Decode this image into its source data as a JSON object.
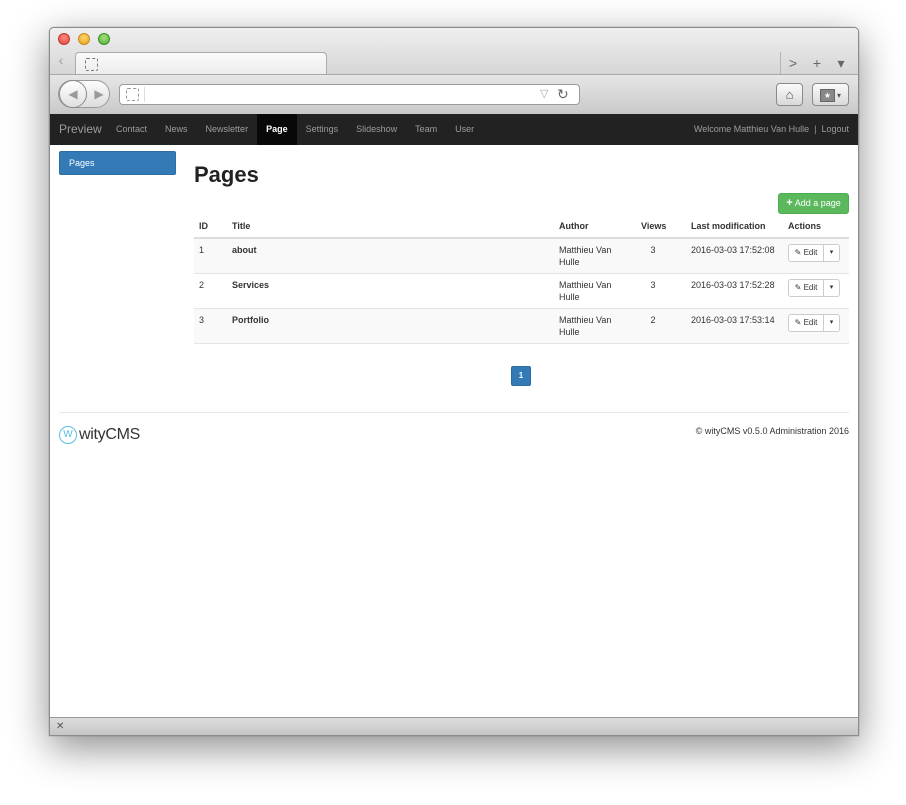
{
  "browser": {
    "tab_back_glyph": "‹",
    "tab_actions": [
      ">",
      "+",
      "▾"
    ],
    "nav_back_glyph": "◀",
    "nav_forward_glyph": "▶",
    "url": "",
    "url_dropdown_glyph": "▽",
    "reload_glyph": "↻",
    "home_glyph": "⌂",
    "bookmarks_glyph": "★",
    "bookmarks_caret": "▾",
    "status_close_glyph": "✕"
  },
  "navbar": {
    "brand": "Preview",
    "items": [
      {
        "label": "Contact"
      },
      {
        "label": "News"
      },
      {
        "label": "Newsletter"
      },
      {
        "label": "Page"
      },
      {
        "label": "Settings"
      },
      {
        "label": "Slideshow"
      },
      {
        "label": "Team"
      },
      {
        "label": "User"
      }
    ],
    "active": "Page",
    "welcome": "Welcome Matthieu Van Hulle",
    "separator": "|",
    "logout": "Logout"
  },
  "sidebar": {
    "items": [
      {
        "label": "Pages"
      }
    ]
  },
  "main": {
    "title": "Pages",
    "add_button": "Add a page",
    "add_icon": "+"
  },
  "table": {
    "headers": {
      "id": "ID",
      "title": "Title",
      "author": "Author",
      "views": "Views",
      "last_modification": "Last modification",
      "actions": "Actions"
    },
    "rows": [
      {
        "id": "1",
        "title": "about",
        "author": "Matthieu Van Hulle",
        "views": "3",
        "last_modification": "2016-03-03 17:52:08",
        "edit": "Edit"
      },
      {
        "id": "2",
        "title": "Services",
        "author": "Matthieu Van Hulle",
        "views": "3",
        "last_modification": "2016-03-03 17:52:28",
        "edit": "Edit"
      },
      {
        "id": "3",
        "title": "Portfolio",
        "author": "Matthieu Van Hulle",
        "views": "2",
        "last_modification": "2016-03-03 17:53:14",
        "edit": "Edit"
      }
    ],
    "edit_icon": "✎",
    "caret_icon": "▾"
  },
  "pagination": {
    "current": "1"
  },
  "footer": {
    "logo_mark": "W",
    "logo_text": "wityCMS",
    "copyright": "© wityCMS v0.5.0 Administration 2016"
  },
  "colors": {
    "navbar_bg": "#222222",
    "primary": "#337ab7",
    "success": "#5cb85c",
    "logo_accent": "#5bc0de"
  }
}
